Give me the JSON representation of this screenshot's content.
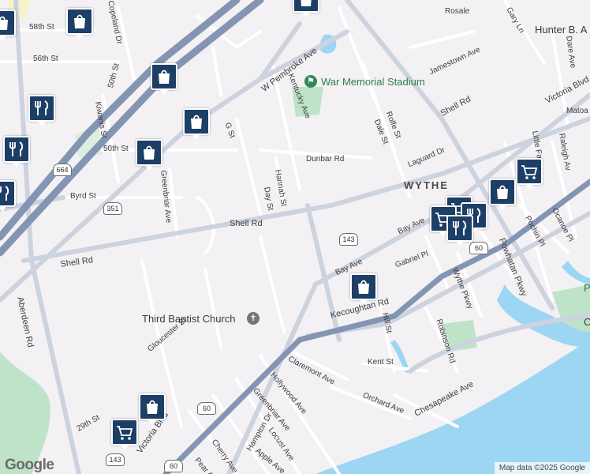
{
  "map": {
    "district": "WYTHE",
    "streets": [
      {
        "name": "58th St"
      },
      {
        "name": "56th St"
      },
      {
        "name": "50th St"
      },
      {
        "name": "50th St"
      },
      {
        "name": "Copeland Dr"
      },
      {
        "name": "Kiwanis St"
      },
      {
        "name": "Byrd St"
      },
      {
        "name": "Greenbriar Ave"
      },
      {
        "name": "Shell Rd"
      },
      {
        "name": "Shell Rd"
      },
      {
        "name": "Shell Rd"
      },
      {
        "name": "W Pembroke Ave"
      },
      {
        "name": "Kentucky Ave"
      },
      {
        "name": "G St"
      },
      {
        "name": "Hannah St"
      },
      {
        "name": "Day St"
      },
      {
        "name": "Dunbar Rd"
      },
      {
        "name": "Rolfe St"
      },
      {
        "name": "Dale St"
      },
      {
        "name": "Laguard Dr"
      },
      {
        "name": "Jamestown Ave"
      },
      {
        "name": "Rosale"
      },
      {
        "name": "Gary Ln"
      },
      {
        "name": "Dare Ave"
      },
      {
        "name": "Victoria Blvd"
      },
      {
        "name": "Matoa"
      },
      {
        "name": "Little Fa"
      },
      {
        "name": "Raleigh Av"
      },
      {
        "name": "Bay Ave"
      },
      {
        "name": "Bay Ave"
      },
      {
        "name": "Gabriel Pl"
      },
      {
        "name": "Pochin Pl"
      },
      {
        "name": "Ocanoe Pl"
      },
      {
        "name": "Powhatan Pkwy"
      },
      {
        "name": "Wythe Pkwy"
      },
      {
        "name": "Kecoughtan Rd"
      },
      {
        "name": "Hill St"
      },
      {
        "name": "Robinson Rd"
      },
      {
        "name": "Kent St"
      },
      {
        "name": "Claremont Ave"
      },
      {
        "name": "Hollywood Ave"
      },
      {
        "name": "Greenbriar Ave"
      },
      {
        "name": "Orchard Ave"
      },
      {
        "name": "Chesapeake Ave"
      },
      {
        "name": "Gloucester St"
      },
      {
        "name": "Aberdeen Rd"
      },
      {
        "name": "Victoria Blvd"
      },
      {
        "name": "29th St"
      },
      {
        "name": "Hampton Dr"
      },
      {
        "name": "Locust Ave"
      },
      {
        "name": "Cherry Ave"
      },
      {
        "name": "Apple Ave"
      },
      {
        "name": "Pear Ave"
      }
    ],
    "pois": [
      {
        "name": "War Memorial Stadium"
      },
      {
        "name": "Third Baptist Church"
      },
      {
        "name": "Hunter B. A"
      },
      {
        "name": "P"
      },
      {
        "name": "C"
      }
    ],
    "shields": [
      "664",
      "351",
      "143",
      "60",
      "60",
      "143",
      "60"
    ],
    "pin_icons": [
      "shopping-bag-icon",
      "restaurant-icon",
      "shopping-cart-icon"
    ],
    "colors": {
      "background": "#f3f1f4",
      "water": "#9cd6f3",
      "highway": "#8395b3",
      "arterial": "#c9d0dc",
      "park": "#bfe3c8",
      "pin": "#1d3f66"
    }
  },
  "branding": {
    "logo": "Google",
    "attribution": "Map data ©2025 Google"
  }
}
